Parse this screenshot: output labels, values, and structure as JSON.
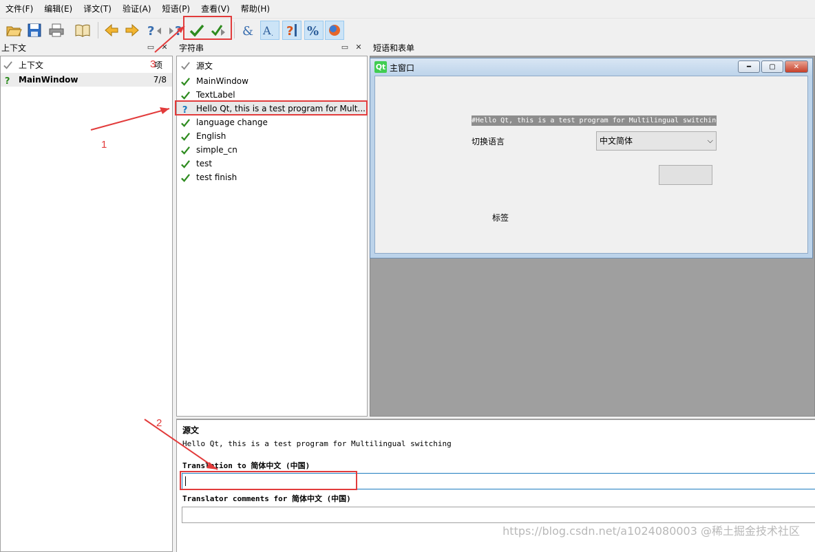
{
  "menu": [
    "文件(F)",
    "编辑(E)",
    "译文(T)",
    "验证(A)",
    "短语(P)",
    "查看(V)",
    "帮助(H)"
  ],
  "toolbar_icons": [
    "open-icon",
    "save-icon",
    "print-icon",
    "book-icon",
    "prev-icon",
    "next-icon",
    "prev-unfinished-icon",
    "next-unfinished-icon",
    "accept-icon",
    "accept-next-icon",
    "accelerators-icon",
    "ending-punctuation-icon",
    "phrase-matches-icon",
    "place-markers-icon",
    "translator-icon"
  ],
  "context_panel": {
    "title": "上下文",
    "header_name": "上下文",
    "header_count": "项",
    "rows": [
      {
        "name": "MainWindow",
        "count": "7/8"
      }
    ]
  },
  "strings_panel": {
    "title": "字符串",
    "header": "源文",
    "items": [
      {
        "text": "MainWindow",
        "status": "done"
      },
      {
        "text": "TextLabel",
        "status": "done"
      },
      {
        "text": "Hello Qt, this is a test program for Mult...",
        "status": "unfinished"
      },
      {
        "text": "language change",
        "status": "done"
      },
      {
        "text": "English",
        "status": "done"
      },
      {
        "text": "simple_cn",
        "status": "done"
      },
      {
        "text": "test",
        "status": "done"
      },
      {
        "text": "test finish",
        "status": "done"
      }
    ]
  },
  "preview_panel": {
    "title": "短语和表单",
    "window_title": "主窗口",
    "qt_logo": "Qt",
    "label_text": "#Hello Qt, this is a test program for Multilingual switching",
    "switch_label": "切换语言",
    "combo_value": "中文简体",
    "tag_label": "标签"
  },
  "editor": {
    "source_heading": "源文",
    "source_text": "Hello Qt, this is a test program for Multilingual switching",
    "translation_label": "Translation to 简体中文 (中国)",
    "translation_value": "",
    "comments_label": "Translator comments for 简体中文 (中国)",
    "comments_value": ""
  },
  "annotations": {
    "n1": "1",
    "n2": "2",
    "n3": "3"
  },
  "watermark": "https://blog.csdn.net/a1024080003 @稀土掘金技术社区",
  "colors": {
    "check_green": "#2e8b1f",
    "annotation_red": "#e23b3b",
    "accent_blue": "#1c7bbf"
  }
}
